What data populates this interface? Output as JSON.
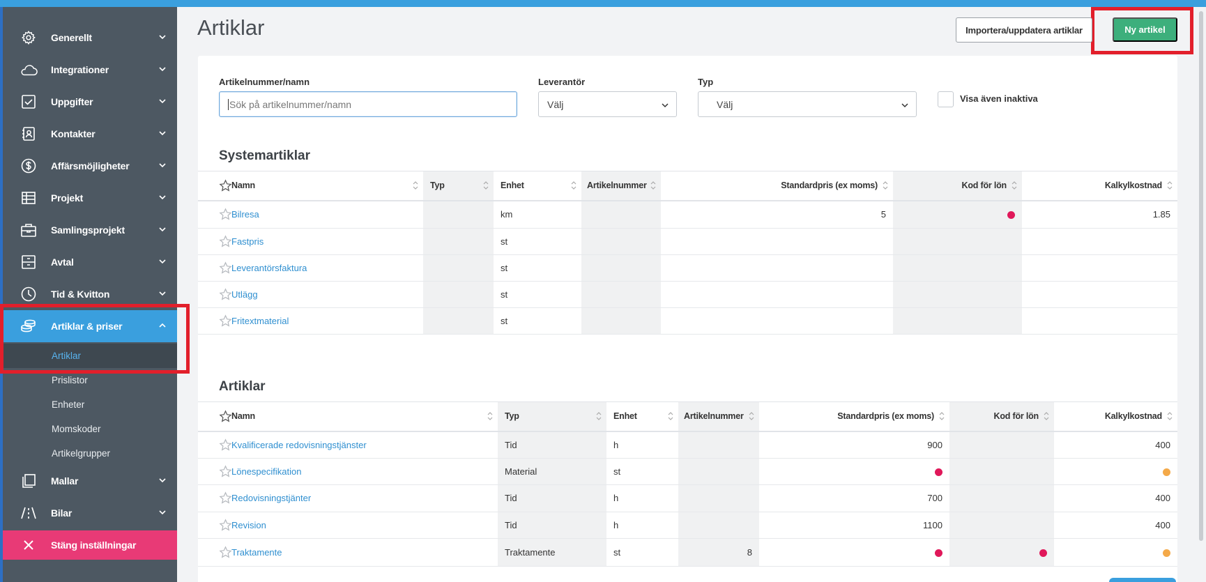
{
  "sidebar": {
    "items": [
      {
        "label": "Generellt",
        "icon": "gear-icon"
      },
      {
        "label": "Integrationer",
        "icon": "cloud-icon"
      },
      {
        "label": "Uppgifter",
        "icon": "checkbox-icon"
      },
      {
        "label": "Kontakter",
        "icon": "contact-book-icon"
      },
      {
        "label": "Affärsmöjligheter",
        "icon": "dollar-circle-icon"
      },
      {
        "label": "Projekt",
        "icon": "table-icon"
      },
      {
        "label": "Samlingsprojekt",
        "icon": "briefcase-icon"
      },
      {
        "label": "Avtal",
        "icon": "cabinet-icon"
      },
      {
        "label": "Tid & Kvitton",
        "icon": "clock-icon"
      },
      {
        "label": "Artiklar & priser",
        "icon": "coins-icon"
      }
    ],
    "subitems": [
      "Artiklar",
      "Prislistor",
      "Enheter",
      "Momskoder",
      "Artikelgrupper"
    ],
    "items_after": [
      {
        "label": "Mallar",
        "icon": "copy-icon"
      },
      {
        "label": "Bilar",
        "icon": "road-icon"
      }
    ],
    "close_label": "Stäng inställningar"
  },
  "page": {
    "title": "Artiklar",
    "import_button": "Importera/uppdatera artiklar",
    "new_button": "Ny artikel"
  },
  "filters": {
    "search_label": "Artikelnummer/namn",
    "search_placeholder": "Sök på artikelnummer/namn",
    "supplier_label": "Leverantör",
    "supplier_value": "Välj",
    "type_label": "Typ",
    "type_value": "Välj",
    "inactive_label": "Visa även inaktiva"
  },
  "system_table": {
    "title": "Systemartiklar",
    "columns": [
      "Namn",
      "Typ",
      "Enhet",
      "Artikelnummer",
      "Standardpris (ex moms)",
      "Kod för lön",
      "Kalkylkostnad"
    ],
    "rows": [
      {
        "name": "Bilresa",
        "typ": "",
        "enhet": "km",
        "artnr": "",
        "pris": "5",
        "kod": "red",
        "kalkyl": "1.85"
      },
      {
        "name": "Fastpris",
        "typ": "",
        "enhet": "st",
        "artnr": "",
        "pris": "",
        "kod": "",
        "kalkyl": ""
      },
      {
        "name": "Leverantörsfaktura",
        "typ": "",
        "enhet": "st",
        "artnr": "",
        "pris": "",
        "kod": "",
        "kalkyl": ""
      },
      {
        "name": "Utlägg",
        "typ": "",
        "enhet": "st",
        "artnr": "",
        "pris": "",
        "kod": "",
        "kalkyl": ""
      },
      {
        "name": "Fritextmaterial",
        "typ": "",
        "enhet": "st",
        "artnr": "",
        "pris": "",
        "kod": "",
        "kalkyl": ""
      }
    ]
  },
  "article_table": {
    "title": "Artiklar",
    "columns": [
      "Namn",
      "Typ",
      "Enhet",
      "Artikelnummer",
      "Standardpris (ex moms)",
      "Kod för lön",
      "Kalkylkostnad"
    ],
    "rows": [
      {
        "name": "Kvalificerade redovisningstjänster",
        "typ": "Tid",
        "enhet": "h",
        "artnr": "",
        "pris": "900",
        "pris_dot": "",
        "kod": "",
        "kalkyl": "400",
        "kalkyl_dot": ""
      },
      {
        "name": "Lönespecifikation",
        "typ": "Material",
        "enhet": "st",
        "artnr": "",
        "pris": "",
        "pris_dot": "red",
        "kod": "",
        "kalkyl": "",
        "kalkyl_dot": "orange"
      },
      {
        "name": "Redovisningstjänter",
        "typ": "Tid",
        "enhet": "h",
        "artnr": "",
        "pris": "700",
        "pris_dot": "",
        "kod": "",
        "kalkyl": "400",
        "kalkyl_dot": ""
      },
      {
        "name": "Revision",
        "typ": "Tid",
        "enhet": "h",
        "artnr": "",
        "pris": "1100",
        "pris_dot": "",
        "kod": "",
        "kalkyl": "400",
        "kalkyl_dot": ""
      },
      {
        "name": "Traktamente",
        "typ": "Traktamente",
        "enhet": "st",
        "artnr": "8",
        "pris": "",
        "pris_dot": "red",
        "kod": "red",
        "kalkyl": "",
        "kalkyl_dot": "orange"
      }
    ]
  },
  "colors": {
    "accent": "#3a9fde",
    "sidebar": "#4d5862",
    "primary_button": "#3daf7c",
    "close": "#e83a76",
    "link": "#2f8fd0",
    "highlight": "#e21f2b",
    "status_red": "#e0185a",
    "status_orange": "#f4a949"
  }
}
